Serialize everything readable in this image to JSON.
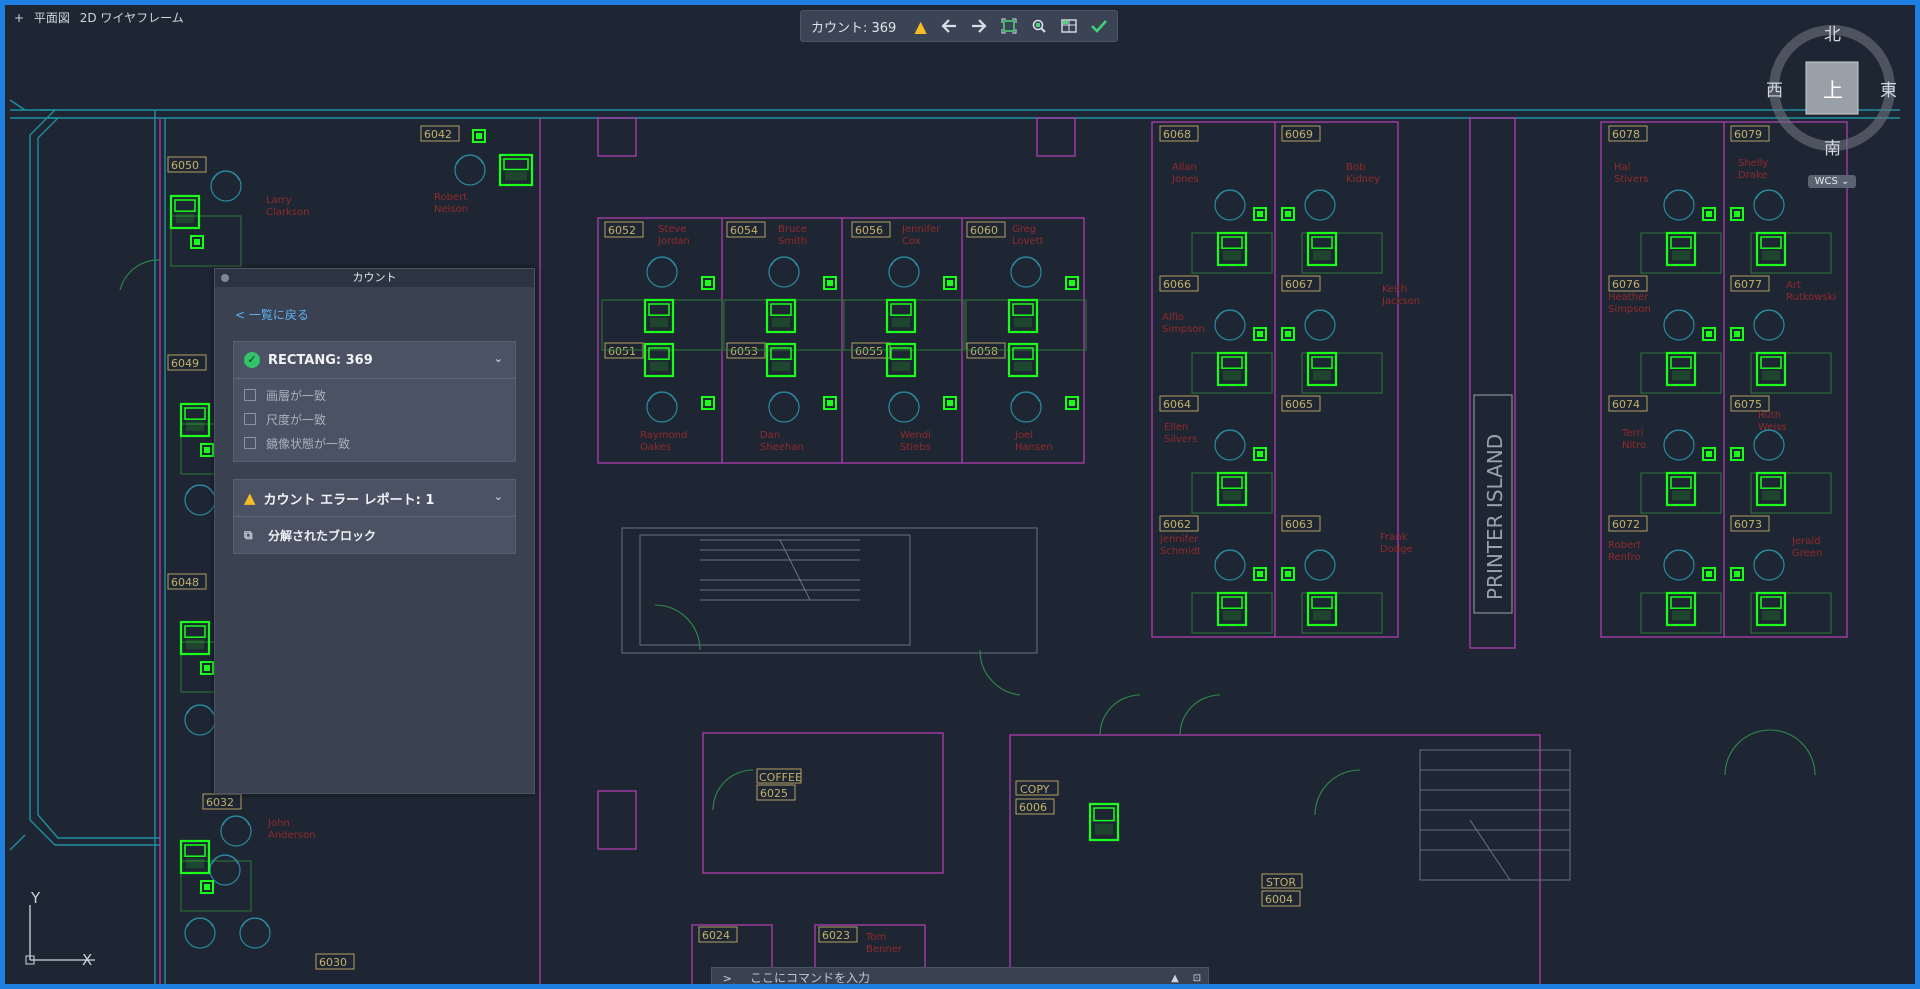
{
  "viewport": {
    "plus": "+",
    "view_name": "平面図",
    "visual_style": "2D ワイヤフレーム"
  },
  "toolbar": {
    "count_label": "カウント: 369",
    "icons": [
      "warning-icon",
      "arrow-left-icon",
      "arrow-right-icon",
      "zoom-extents-icon",
      "find-icon",
      "table-icon",
      "check-icon"
    ]
  },
  "viewcube": {
    "north": "北",
    "south": "南",
    "east": "東",
    "west": "西",
    "top": "上",
    "wcs": "WCS"
  },
  "panel": {
    "title": "カウント",
    "back": "< 一覧に戻る",
    "item_title": "RECTANG: 369",
    "checks": [
      "画層が一致",
      "尺度が一致",
      "鏡像状態が一致"
    ],
    "error_title": "カウント エラー レポート: 1",
    "error_item": "分解されたブロック"
  },
  "cmd": {
    "prompt": ">_",
    "placeholder": "ここにコマンドを入力"
  },
  "ucs": {
    "x": "X",
    "y": "Y"
  },
  "colors": {
    "accent": "#1f7fe0",
    "background": "#1f2633",
    "highlight": "#19ff19",
    "wall": "#b53bb5",
    "cyan": "#1f8fa0",
    "room_label": "#b0a060",
    "name": "#8f2525"
  },
  "rooms": [
    {
      "num": "6050"
    },
    {
      "num": "6042"
    },
    {
      "num": "6049"
    },
    {
      "num": "6048"
    },
    {
      "num": "6032"
    },
    {
      "num": "6030"
    },
    {
      "num": "6052"
    },
    {
      "num": "6054"
    },
    {
      "num": "6056"
    },
    {
      "num": "6060"
    },
    {
      "num": "6051"
    },
    {
      "num": "6053"
    },
    {
      "num": "6055"
    },
    {
      "num": "6058"
    },
    {
      "num": "6068"
    },
    {
      "num": "6069"
    },
    {
      "num": "6066"
    },
    {
      "num": "6067"
    },
    {
      "num": "6064"
    },
    {
      "num": "6065"
    },
    {
      "num": "6062"
    },
    {
      "num": "6063"
    },
    {
      "num": "6078"
    },
    {
      "num": "6079"
    },
    {
      "num": "6076"
    },
    {
      "num": "6077"
    },
    {
      "num": "6074"
    },
    {
      "num": "6075"
    },
    {
      "num": "6072"
    },
    {
      "num": "6073"
    },
    {
      "num": "6025"
    },
    {
      "num": "6006"
    },
    {
      "num": "6004"
    },
    {
      "num": "6024"
    },
    {
      "num": "6023"
    }
  ],
  "special_labels": {
    "coffee": "COFFEE",
    "copy": "COPY",
    "stor": "STOR",
    "printer": "PRINTER ISLAND"
  },
  "names": [
    "Larry Clarkson",
    "Robert Nelson",
    "Steve Jordan",
    "Bruce Smith",
    "Jennifer Cox",
    "Greg Lovett",
    "Raymond Oakes",
    "Dan Sheehan",
    "Wendi Stiebs",
    "Joel Hansen",
    "Allan Jones",
    "Bob Kidney",
    "Alfio Simpson",
    "Keith Jackson",
    "Ellen Silvers",
    "Jennifer Schmidt",
    "Frank Dodge",
    "Hal Stivers",
    "Shelly Drake",
    "Heather Simpson",
    "Art Rutkowski",
    "Terri Nitro",
    "Ruth Weiss",
    "Robert Renfro",
    "Jerald Green",
    "John Anderson",
    "Tom Benner"
  ]
}
